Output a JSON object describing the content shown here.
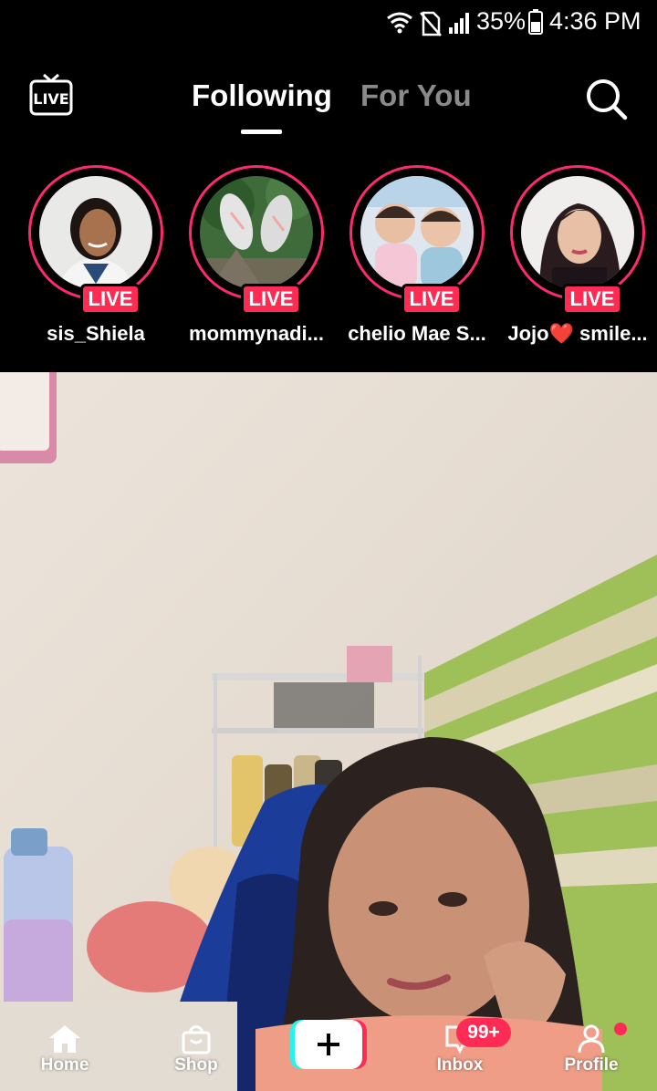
{
  "status_bar": {
    "battery": "35%",
    "time": "4:36 PM"
  },
  "top_nav": {
    "live_icon_text": "LIVE",
    "tabs": [
      {
        "label": "Following",
        "active": true
      },
      {
        "label": "For You",
        "active": false
      }
    ]
  },
  "stories": [
    {
      "name": "sis_Shiela",
      "badge": "LIVE"
    },
    {
      "name": "mommynadi...",
      "badge": "LIVE"
    },
    {
      "name": "chelio Mae S...",
      "badge": "LIVE"
    },
    {
      "name": "Jojo❤️ smile...",
      "badge": "LIVE"
    }
  ],
  "bottom_nav": {
    "home": "Home",
    "shop": "Shop",
    "inbox": "Inbox",
    "inbox_badge": "99+",
    "profile": "Profile"
  },
  "colors": {
    "live_pink": "#fe2c55",
    "ring_pink": "#ff2a6d"
  }
}
